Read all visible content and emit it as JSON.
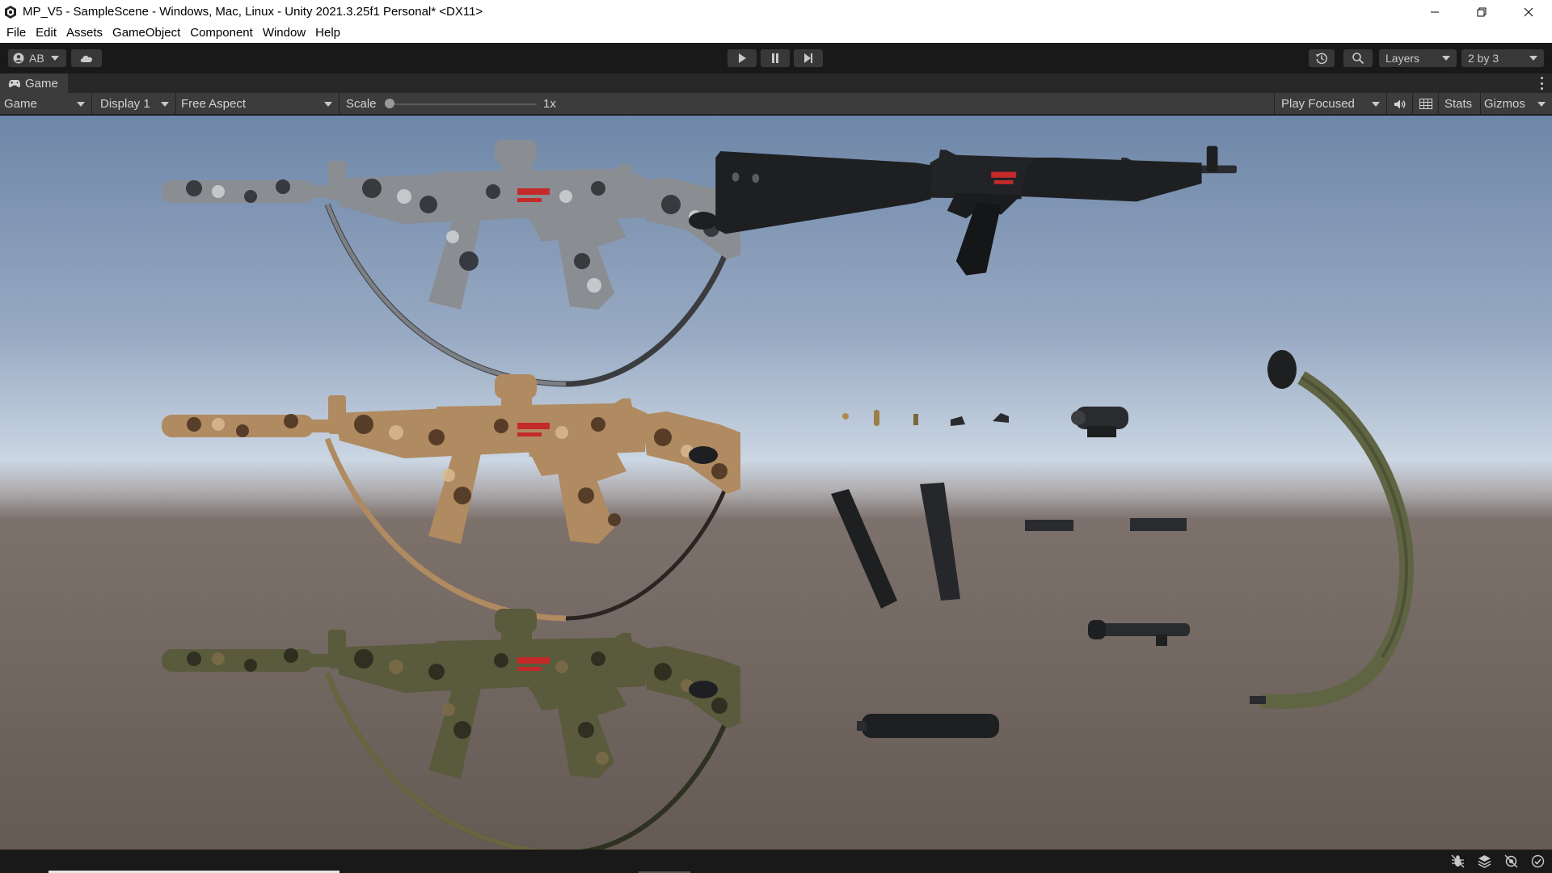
{
  "window": {
    "title": "MP_V5 - SampleScene - Windows, Mac, Linux - Unity 2021.3.25f1 Personal* <DX11>",
    "icon": "unity-logo-icon",
    "controls": [
      "minimize-icon",
      "restore-icon",
      "close-icon"
    ]
  },
  "menu": {
    "items": [
      "File",
      "Edit",
      "Assets",
      "GameObject",
      "Component",
      "Window",
      "Help"
    ]
  },
  "toolbar": {
    "account_label": "AB",
    "cloud_icon": "cloud-icon",
    "play_icon": "play-icon",
    "pause_icon": "pause-icon",
    "step_icon": "step-icon",
    "history_icon": "history-icon",
    "search_icon": "search-icon",
    "layers_label": "Layers",
    "layout_label": "2 by 3"
  },
  "tab": {
    "label": "Game",
    "icon": "gamepad-icon"
  },
  "game_toolbar": {
    "view_label": "Game",
    "display_label": "Display 1",
    "aspect_label": "Free Aspect",
    "scale_label": "Scale",
    "scale_value": "1x",
    "scale_slider_fraction": 0.0,
    "play_mode_label": "Play Focused",
    "mute_icon": "speaker-icon",
    "grid_icon": "grid-icon",
    "stats_label": "Stats",
    "gizmos_label": "Gizmos"
  },
  "scene": {
    "sky_top_color": "#6f86a8",
    "sky_horizon_color": "#c8d4e2",
    "ground_color": "#6b5f5a",
    "rifles": [
      {
        "camo": "urban-gray",
        "base": "#8a8d92",
        "spot1": "#3a3c40",
        "spot2": "#c4c6c9"
      },
      {
        "camo": "desert-tan",
        "base": "#b08a60",
        "spot1": "#5a3f28",
        "spot2": "#d6b48a"
      },
      {
        "camo": "woodland-green",
        "base": "#5a5a3c",
        "spot1": "#2e3020",
        "spot2": "#7a6a48"
      }
    ],
    "plain_rifle_color": "#1e1f21",
    "parts": [
      "round",
      "cartridge",
      "small-part",
      "rear-sight",
      "front-sight",
      "red-dot-sight",
      "magazine-curved",
      "magazine-straight",
      "rail-short",
      "rail-long",
      "flashlight",
      "suppressor",
      "sling"
    ]
  },
  "statusbar": {
    "icons": [
      "bug-icon",
      "layers-icon",
      "lighting-icon",
      "check-circle-icon"
    ]
  }
}
